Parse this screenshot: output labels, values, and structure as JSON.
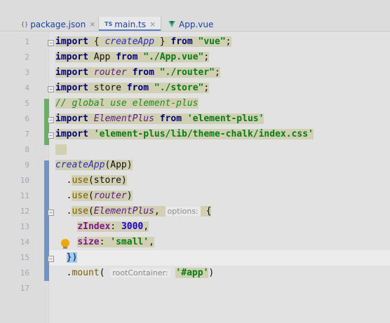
{
  "tabs": [
    {
      "icon": "{}",
      "label": "package.json",
      "close": "×"
    },
    {
      "icon": "TS",
      "label": "main.ts",
      "close": "×"
    },
    {
      "icon": "vue-icon",
      "label": "App.vue",
      "close": ""
    }
  ],
  "line_numbers": [
    "1",
    "2",
    "3",
    "4",
    "5",
    "6",
    "7",
    "8",
    "9",
    "10",
    "11",
    "12",
    "13",
    "14",
    "15",
    "16",
    "17"
  ],
  "code": {
    "l1": {
      "kw1": "import",
      "p1": " { ",
      "id": "createApp",
      "p2": " } ",
      "kw2": "from",
      "sp": " ",
      "str": "\"vue\"",
      "end": ";"
    },
    "l2": {
      "kw1": "import",
      "p1": " App ",
      "kw2": "from",
      "sp": " ",
      "str": "\"./App.vue\"",
      "end": ";"
    },
    "l3": {
      "kw1": "import",
      "sp1": " ",
      "id": "router",
      "sp2": " ",
      "kw2": "from",
      "sp": " ",
      "str": "\"./router\"",
      "end": ";"
    },
    "l4": {
      "kw1": "import",
      "p1": " store ",
      "kw2": "from",
      "sp": " ",
      "str": "\"./store\"",
      "end": ";"
    },
    "l5": {
      "comment": "// global use element-plus"
    },
    "l6": {
      "kw1": "import",
      "sp1": " ",
      "id": "ElementPlus",
      "sp2": " ",
      "kw2": "from",
      "sp": " ",
      "str": "'element-plus'"
    },
    "l7": {
      "kw1": "import",
      "sp": " ",
      "str": "'element-plus/lib/theme-chalk/index.css'"
    },
    "l9": {
      "fn": "createApp",
      "rest": "(App)"
    },
    "l10": {
      "pre": "  .",
      "fn": "use",
      "rest": "(store)"
    },
    "l11": {
      "pre": "  .",
      "fn": "use",
      "p1": "(",
      "id": "router",
      "p2": ")"
    },
    "l12": {
      "pre": "  .",
      "fn": "use",
      "p1": "(",
      "id": "ElementPlus",
      "p2": ", ",
      "hint": "options:",
      "p3": " {"
    },
    "l13": {
      "pre": "    ",
      "prop": "zIndex",
      "p1": ": ",
      "num": "3000",
      "end": ","
    },
    "l14": {
      "pre": "    ",
      "prop": "size",
      "p1": ": ",
      "str": "'small'",
      "end": ","
    },
    "l15": {
      "pre": "  ",
      "brace": "}",
      "paren": ")"
    },
    "l16": {
      "pre": "  .",
      "fn": "mount",
      "p1": "( ",
      "hint": "rootContainer:",
      "sp": " ",
      "str": "'#app'",
      "p2": ")"
    }
  }
}
